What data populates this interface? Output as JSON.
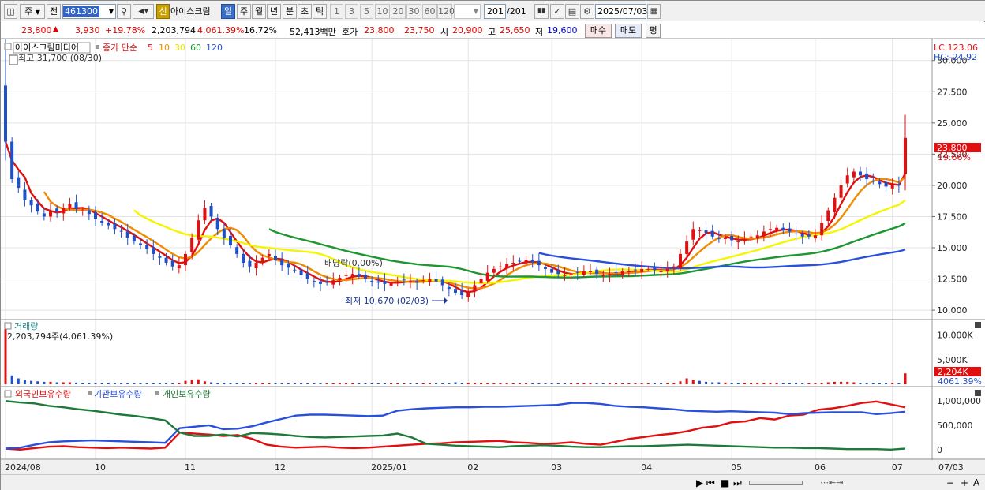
{
  "toolbar": {
    "market_code": "주",
    "prev_label": "전",
    "stock_code": "461300",
    "sin_badge": "신",
    "stock_name": "아이스크림",
    "period_buttons": [
      "일",
      "주",
      "월",
      "년",
      "분",
      "초",
      "틱"
    ],
    "period_active": "일",
    "interval_buttons": [
      "1",
      "3",
      "5",
      "10",
      "20",
      "30",
      "60",
      "120"
    ],
    "count_value": "201",
    "count_total": "/201",
    "date_value": "2025/07/03"
  },
  "quote": {
    "price": "23,800",
    "change": "3,930",
    "change_pct": "+19.78%",
    "volume": "2,203,794",
    "volume_pct": "4,061.39%",
    "turnover": "16.72%",
    "trade_amount": "52,413백만",
    "hoga_label": "호가",
    "ask": "23,800",
    "bid": "23,750",
    "open_label": "시",
    "open": "20,900",
    "high_label": "고",
    "high": "25,650",
    "low_label": "저",
    "low": "19,600",
    "buy_label": "매수",
    "sell_label": "매도",
    "eval_label": "평"
  },
  "price_pane": {
    "name_label": "아이스크림미디어",
    "ma_label": "종가 단순",
    "ma_periods": [
      "5",
      "10",
      "30",
      "60",
      "120"
    ],
    "high_note": "최고 31,700 (08/30)",
    "low_note": "최저 10,670 (02/03)",
    "dividend_note": "배당락(0.00%)",
    "lc_label": "LC:123.06",
    "hc_label": "HC:-24.92",
    "current_price_tag": "23,800",
    "current_pct_tag": "19.66%"
  },
  "volume_pane": {
    "title": "거래량",
    "value_label": "2,203,794주(4,061.39%)",
    "current_tag": "2,204K",
    "current_pct": "4061.39%"
  },
  "holdings_pane": {
    "legend": [
      "외국인보유수량",
      "기관보유수량",
      "개인보유수량"
    ]
  },
  "x_axis": {
    "labels": [
      "2024/08",
      "10",
      "11",
      "12",
      "2025/01",
      "02",
      "03",
      "04",
      "05",
      "06",
      "07"
    ],
    "right_label": "07/03"
  },
  "colors": {
    "ma5": "#e01010",
    "ma10": "#f08c00",
    "ma30": "#f5f500",
    "ma60": "#1e9632",
    "ma120": "#2850dc",
    "up": "#e01010",
    "down": "#1e50c8"
  },
  "chart_data": [
    {
      "type": "candlestick",
      "title": "아이스크림미디어",
      "ylim": [
        9500,
        31500
      ],
      "y_ticks": [
        10000,
        12500,
        15000,
        17500,
        20000,
        22500,
        25000,
        27500,
        30000
      ],
      "y_tick_labels": [
        "10,000",
        "12,500",
        "15,000",
        "17,500",
        "20,000",
        "22,500",
        "25,000",
        "27,500",
        "30,000"
      ],
      "x_labels": [
        "2024/08",
        "10",
        "11",
        "12",
        "2025/01",
        "02",
        "03",
        "04",
        "05",
        "06",
        "07"
      ],
      "close": [
        23500,
        20500,
        19800,
        18800,
        18400,
        17900,
        17500,
        18000,
        17900,
        18200,
        18500,
        18100,
        18000,
        17700,
        17300,
        17000,
        16800,
        16500,
        16300,
        15800,
        15500,
        15200,
        14900,
        14500,
        14200,
        13800,
        13500,
        13600,
        14500,
        15800,
        17200,
        18200,
        17500,
        16500,
        15800,
        15200,
        14500,
        13800,
        13500,
        13800,
        14200,
        14500,
        14000,
        13600,
        13400,
        13200,
        12800,
        12500,
        12300,
        12100,
        12200,
        12400,
        12600,
        12800,
        12900,
        12700,
        12500,
        12300,
        12200,
        12100,
        12200,
        12300,
        12400,
        12300,
        12200,
        12400,
        12500,
        12300,
        12000,
        11700,
        11400,
        11200,
        11500,
        12000,
        12500,
        13000,
        13300,
        13500,
        13700,
        13800,
        13900,
        14000,
        13800,
        13600,
        13300,
        13000,
        12900,
        12800,
        12900,
        13000,
        13100,
        13100,
        12900,
        12800,
        12900,
        13000,
        13100,
        13100,
        13200,
        13300,
        13300,
        13200,
        13100,
        13300,
        13500,
        14500,
        15500,
        16500,
        16400,
        16200,
        15900,
        15700,
        15800,
        15600,
        15500,
        15700,
        15900,
        16000,
        16300,
        16500,
        16600,
        16400,
        16300,
        16100,
        15900,
        15900,
        16000,
        17000,
        18000,
        19000,
        20000,
        20800,
        21100,
        20800,
        20500,
        20300,
        20100,
        19900,
        20100,
        20000,
        23800
      ],
      "ma_periods": [
        5,
        10,
        30,
        60,
        120
      ]
    },
    {
      "type": "bar",
      "title": "거래량",
      "ylim": [
        0,
        12000
      ],
      "y_ticks": [
        5000,
        10000
      ],
      "y_tick_labels": [
        "5,000K",
        "10,000K"
      ],
      "values_k": [
        15500,
        1800,
        1200,
        900,
        700,
        600,
        500,
        500,
        400,
        400,
        400,
        350,
        300,
        300,
        300,
        300,
        300,
        250,
        250,
        250,
        250,
        250,
        250,
        250,
        250,
        200,
        200,
        250,
        700,
        900,
        1000,
        600,
        400,
        300,
        300,
        300,
        250,
        250,
        250,
        250,
        250,
        250,
        250,
        200,
        200,
        200,
        200,
        200,
        200,
        200,
        200,
        200,
        250,
        250,
        250,
        200,
        200,
        200,
        200,
        200,
        200,
        200,
        200,
        200,
        200,
        200,
        200,
        200,
        250,
        250,
        400,
        300,
        300,
        300,
        300,
        250,
        250,
        250,
        250,
        200,
        200,
        200,
        200,
        200,
        200,
        200,
        200,
        200,
        200,
        200,
        200,
        200,
        200,
        200,
        200,
        200,
        200,
        200,
        200,
        200,
        200,
        250,
        250,
        300,
        300,
        600,
        1200,
        900,
        700,
        500,
        400,
        400,
        350,
        300,
        300,
        300,
        300,
        300,
        300,
        300,
        300,
        300,
        300,
        300,
        250,
        250,
        250,
        300,
        400,
        500,
        500,
        500,
        400,
        300,
        300,
        300,
        300,
        300,
        300,
        300,
        2204
      ]
    },
    {
      "type": "line",
      "title": "보유수량",
      "ylim": [
        -150000,
        1150000
      ],
      "y_ticks": [
        0,
        500000,
        1000000
      ],
      "y_tick_labels": [
        "0",
        "500,000",
        "1,000,000"
      ],
      "series": [
        {
          "name": "외국인보유수량",
          "values": [
            20000,
            0,
            30000,
            60000,
            70000,
            50000,
            40000,
            30000,
            40000,
            30000,
            20000,
            40000,
            350000,
            330000,
            310000,
            280000,
            300000,
            220000,
            100000,
            60000,
            40000,
            50000,
            60000,
            40000,
            30000,
            40000,
            60000,
            80000,
            100000,
            120000,
            130000,
            150000,
            160000,
            170000,
            180000,
            150000,
            140000,
            120000,
            130000,
            150000,
            120000,
            100000,
            160000,
            220000,
            260000,
            300000,
            330000,
            380000,
            450000,
            480000,
            560000,
            580000,
            650000,
            620000,
            700000,
            720000,
            820000,
            850000,
            900000,
            960000,
            990000,
            930000,
            870000
          ]
        },
        {
          "name": "기관보유수량",
          "values": [
            20000,
            40000,
            100000,
            150000,
            170000,
            180000,
            190000,
            180000,
            170000,
            160000,
            150000,
            140000,
            440000,
            470000,
            500000,
            420000,
            430000,
            480000,
            560000,
            630000,
            700000,
            720000,
            720000,
            710000,
            700000,
            690000,
            700000,
            800000,
            830000,
            850000,
            860000,
            870000,
            870000,
            880000,
            880000,
            890000,
            900000,
            910000,
            920000,
            960000,
            960000,
            940000,
            900000,
            880000,
            870000,
            850000,
            830000,
            800000,
            790000,
            780000,
            790000,
            780000,
            770000,
            760000,
            730000,
            750000,
            760000,
            770000,
            770000,
            770000,
            730000,
            750000,
            780000
          ]
        },
        {
          "name": "개인보유수량",
          "values": [
            1000000,
            970000,
            950000,
            900000,
            870000,
            830000,
            800000,
            760000,
            720000,
            690000,
            650000,
            600000,
            350000,
            280000,
            280000,
            310000,
            270000,
            340000,
            330000,
            310000,
            280000,
            260000,
            250000,
            260000,
            270000,
            280000,
            290000,
            330000,
            250000,
            120000,
            100000,
            80000,
            70000,
            60000,
            50000,
            70000,
            80000,
            90000,
            80000,
            60000,
            50000,
            50000,
            60000,
            70000,
            70000,
            80000,
            90000,
            100000,
            90000,
            80000,
            70000,
            60000,
            50000,
            40000,
            40000,
            30000,
            30000,
            20000,
            10000,
            10000,
            10000,
            0,
            20000
          ]
        }
      ]
    }
  ]
}
